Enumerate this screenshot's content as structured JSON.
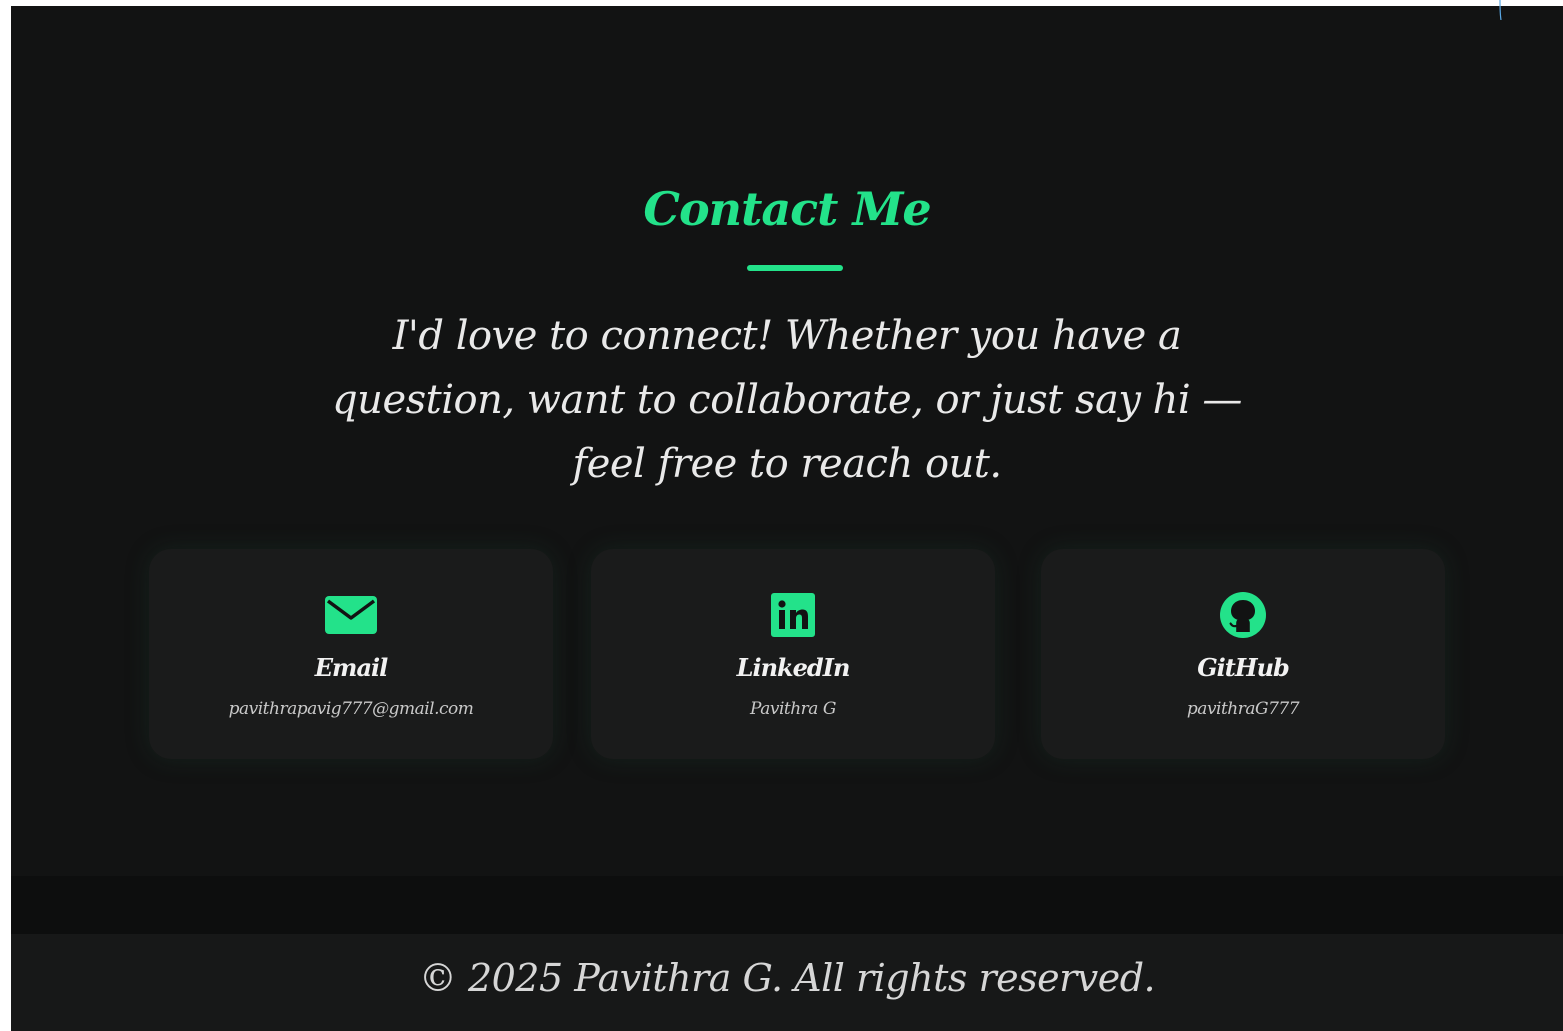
{
  "contact": {
    "title": "Contact Me",
    "intro": "I'd love to connect! Whether you have a question, want to collaborate, or just say hi — feel free to reach out."
  },
  "cards": [
    {
      "icon": "envelope-icon",
      "label": "Email",
      "value": "pavithrapavig777@gmail.com"
    },
    {
      "icon": "linkedin-icon",
      "label": "LinkedIn",
      "value": "Pavithra G"
    },
    {
      "icon": "github-icon",
      "label": "GitHub",
      "value": "pavithraG777"
    }
  ],
  "footer": {
    "copyright": "© 2025 Pavithra G. All rights reserved."
  },
  "colors": {
    "accent": "#23e28a",
    "background": "#121313",
    "card": "#1a1b1b",
    "footer": "#171818"
  }
}
